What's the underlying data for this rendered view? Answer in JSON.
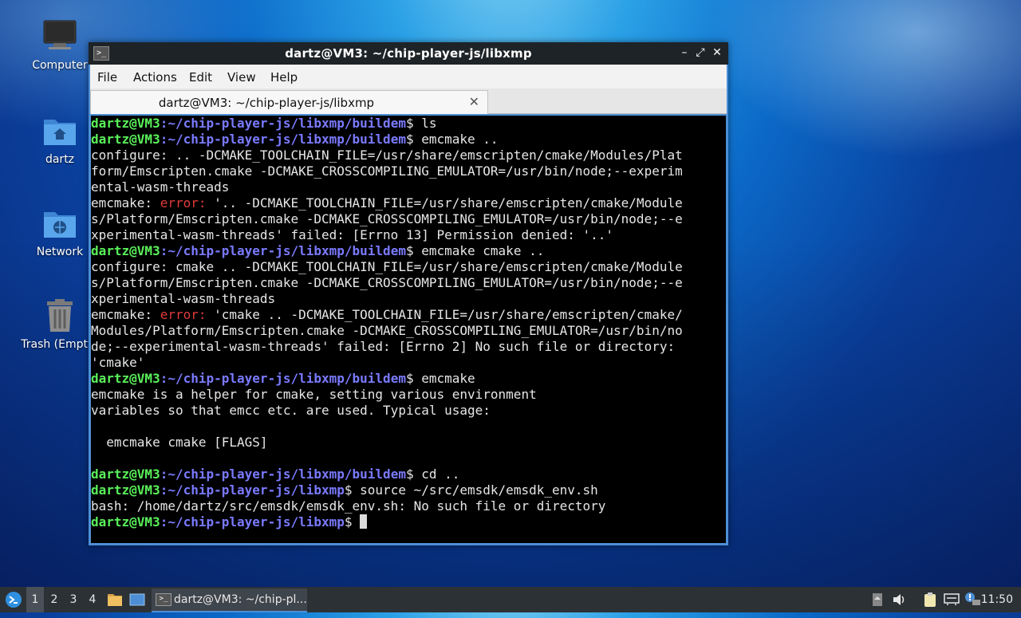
{
  "desktop": {
    "icons": [
      {
        "name": "computer",
        "label": "Computer"
      },
      {
        "name": "home",
        "label": "dartz"
      },
      {
        "name": "network",
        "label": "Network"
      },
      {
        "name": "trash",
        "label": "Trash (Empty)"
      }
    ]
  },
  "window": {
    "title": "dartz@VM3: ~/chip-player-js/libxmp",
    "buttons": {
      "minimize": "–",
      "maximize": "⤢",
      "close": "✕"
    },
    "menu": [
      "File",
      "Actions",
      "Edit",
      "View",
      "Help"
    ],
    "tab": {
      "title": "dartz@VM3: ~/chip-player-js/libxmp",
      "close": "✕"
    },
    "terminal": {
      "prompt_user": "dartz@VM3",
      "lines": [
        [
          {
            "t": "dartz@VM3",
            "c": "p-user"
          },
          {
            "t": ":~/chip-player-js/libxmp/buildem",
            "c": "p-path"
          },
          {
            "t": "$ ls",
            "c": ""
          }
        ],
        [
          {
            "t": "dartz@VM3",
            "c": "p-user"
          },
          {
            "t": ":~/chip-player-js/libxmp/buildem",
            "c": "p-path"
          },
          {
            "t": "$ emcmake ..",
            "c": ""
          }
        ],
        [
          {
            "t": "configure: .. -DCMAKE_TOOLCHAIN_FILE=/usr/share/emscripten/cmake/Modules/Plat",
            "c": ""
          }
        ],
        [
          {
            "t": "form/Emscripten.cmake -DCMAKE_CROSSCOMPILING_EMULATOR=/usr/bin/node;--experim",
            "c": ""
          }
        ],
        [
          {
            "t": "ental-wasm-threads",
            "c": ""
          }
        ],
        [
          {
            "t": "emcmake: ",
            "c": ""
          },
          {
            "t": "error:",
            "c": "err"
          },
          {
            "t": " '.. -DCMAKE_TOOLCHAIN_FILE=/usr/share/emscripten/cmake/Module",
            "c": ""
          }
        ],
        [
          {
            "t": "s/Platform/Emscripten.cmake -DCMAKE_CROSSCOMPILING_EMULATOR=/usr/bin/node;--e",
            "c": ""
          }
        ],
        [
          {
            "t": "xperimental-wasm-threads' failed: [Errno 13] Permission denied: '..'",
            "c": ""
          }
        ],
        [
          {
            "t": "dartz@VM3",
            "c": "p-user"
          },
          {
            "t": ":~/chip-player-js/libxmp/buildem",
            "c": "p-path"
          },
          {
            "t": "$ emcmake cmake ..",
            "c": ""
          }
        ],
        [
          {
            "t": "configure: cmake .. -DCMAKE_TOOLCHAIN_FILE=/usr/share/emscripten/cmake/Module",
            "c": ""
          }
        ],
        [
          {
            "t": "s/Platform/Emscripten.cmake -DCMAKE_CROSSCOMPILING_EMULATOR=/usr/bin/node;--e",
            "c": ""
          }
        ],
        [
          {
            "t": "xperimental-wasm-threads",
            "c": ""
          }
        ],
        [
          {
            "t": "emcmake: ",
            "c": ""
          },
          {
            "t": "error:",
            "c": "err"
          },
          {
            "t": " 'cmake .. -DCMAKE_TOOLCHAIN_FILE=/usr/share/emscripten/cmake/",
            "c": ""
          }
        ],
        [
          {
            "t": "Modules/Platform/Emscripten.cmake -DCMAKE_CROSSCOMPILING_EMULATOR=/usr/bin/no",
            "c": ""
          }
        ],
        [
          {
            "t": "de;--experimental-wasm-threads' failed: [Errno 2] No such file or directory:",
            "c": ""
          }
        ],
        [
          {
            "t": "'cmake'",
            "c": ""
          }
        ],
        [
          {
            "t": "dartz@VM3",
            "c": "p-user"
          },
          {
            "t": ":~/chip-player-js/libxmp/buildem",
            "c": "p-path"
          },
          {
            "t": "$ emcmake",
            "c": ""
          }
        ],
        [
          {
            "t": "emcmake is a helper for cmake, setting various environment",
            "c": ""
          }
        ],
        [
          {
            "t": "variables so that emcc etc. are used. Typical usage:",
            "c": ""
          }
        ],
        [
          {
            "t": "",
            "c": ""
          }
        ],
        [
          {
            "t": "  emcmake cmake [FLAGS]",
            "c": ""
          }
        ],
        [
          {
            "t": "",
            "c": ""
          }
        ],
        [
          {
            "t": "dartz@VM3",
            "c": "p-user"
          },
          {
            "t": ":~/chip-player-js/libxmp/buildem",
            "c": "p-path"
          },
          {
            "t": "$ cd ..",
            "c": ""
          }
        ],
        [
          {
            "t": "dartz@VM3",
            "c": "p-user"
          },
          {
            "t": ":~/chip-player-js/libxmp",
            "c": "p-path"
          },
          {
            "t": "$ source ~/src/emsdk/emsdk_env.sh",
            "c": ""
          }
        ],
        [
          {
            "t": "bash: /home/dartz/src/emsdk/emsdk_env.sh: No such file or directory",
            "c": ""
          }
        ],
        [
          {
            "t": "dartz@VM3",
            "c": "p-user"
          },
          {
            "t": ":~/chip-player-js/libxmp",
            "c": "p-path"
          },
          {
            "t": "$ ",
            "c": ""
          },
          {
            "t": "",
            "c": "cursor"
          }
        ]
      ]
    }
  },
  "taskbar": {
    "workspaces": [
      "1",
      "2",
      "3",
      "4"
    ],
    "active_workspace": "1",
    "task_label": "dartz@VM3: ~/chip-pl...",
    "clock": "11:50"
  },
  "colors": {
    "prompt_user": "#5af05a",
    "prompt_path": "#7a7aff",
    "error": "#e23a3a",
    "window_border": "#4d8fd6"
  }
}
